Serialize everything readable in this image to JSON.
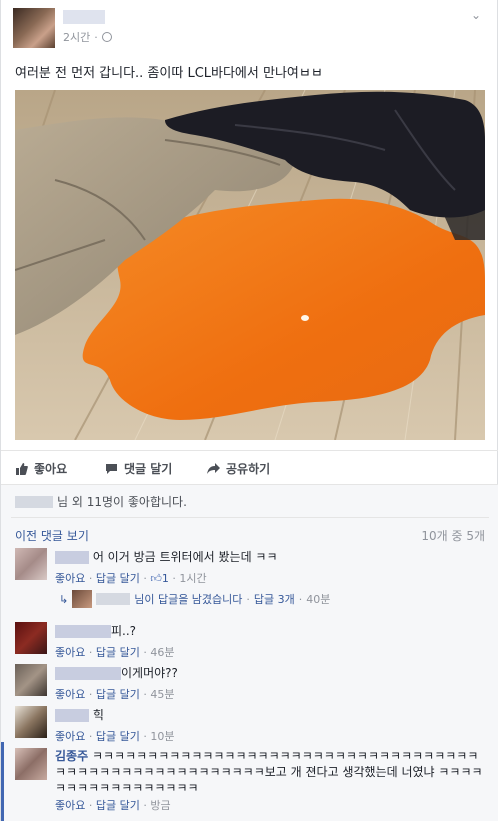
{
  "post": {
    "time": "2시간",
    "time_separator": "·",
    "text": "여러분 전 먼저 갑니다.. 좀이따 LCL바다에서 만나여ㅂㅂ",
    "photo_icon": "photo-spilled-orange-liquid"
  },
  "actions": {
    "like": "좋아요",
    "comment": "댓글 달기",
    "share": "공유하기"
  },
  "likes": {
    "text": "님 외 11명이 좋아합니다."
  },
  "comments_header": {
    "previous": "이전 댓글 보기",
    "count": "10개 중 5개"
  },
  "comments": [
    {
      "text": "어 이거 방금 트위터에서 봤는데 ㅋㅋ",
      "like": "좋아요",
      "sep": "·",
      "reply": "답글 달기",
      "reactions": "1",
      "time": "1시간"
    },
    {
      "text": "피..?",
      "like": "좋아요",
      "sep": "·",
      "reply": "답글 달기",
      "time": "46분"
    },
    {
      "text": "이게머야??",
      "like": "좋아요",
      "sep": "·",
      "reply": "답글 달기",
      "time": "45분"
    },
    {
      "text": "힉",
      "like": "좋아요",
      "sep": "·",
      "reply": "답글 달기",
      "time": "10분"
    },
    {
      "name": "김종주",
      "text": "ㅋㅋㅋㅋㅋㅋㅋㅋㅋㅋㅋㅋㅋㅋㅋㅋㅋㅋㅋㅋㅋㅋㅋㅋㅋㅋㅋㅋㅋㅋㅋㅋㅋㅋㅋㅋㅋㅋㅋㅋㅋㅋㅋㅋㅋㅋㅋㅋㅋㅋㅋㅋㅋㅋ보고 개 젼다고 생각했는데 너였냐 ㅋㅋㅋㅋㅋㅋㅋㅋㅋㅋㅋㅋㅋㅋㅋㅋㅋ",
      "like": "좋아요",
      "sep": "·",
      "reply": "답글 달기",
      "time": "방금"
    }
  ],
  "reply_summary": {
    "text": "님이 답글을 남겼습니다",
    "sep": "·",
    "replies": "답글 3개",
    "time": "40분"
  },
  "colors": {
    "link": "#365899",
    "meta": "#90949c",
    "liquid": "#f07a1a"
  }
}
